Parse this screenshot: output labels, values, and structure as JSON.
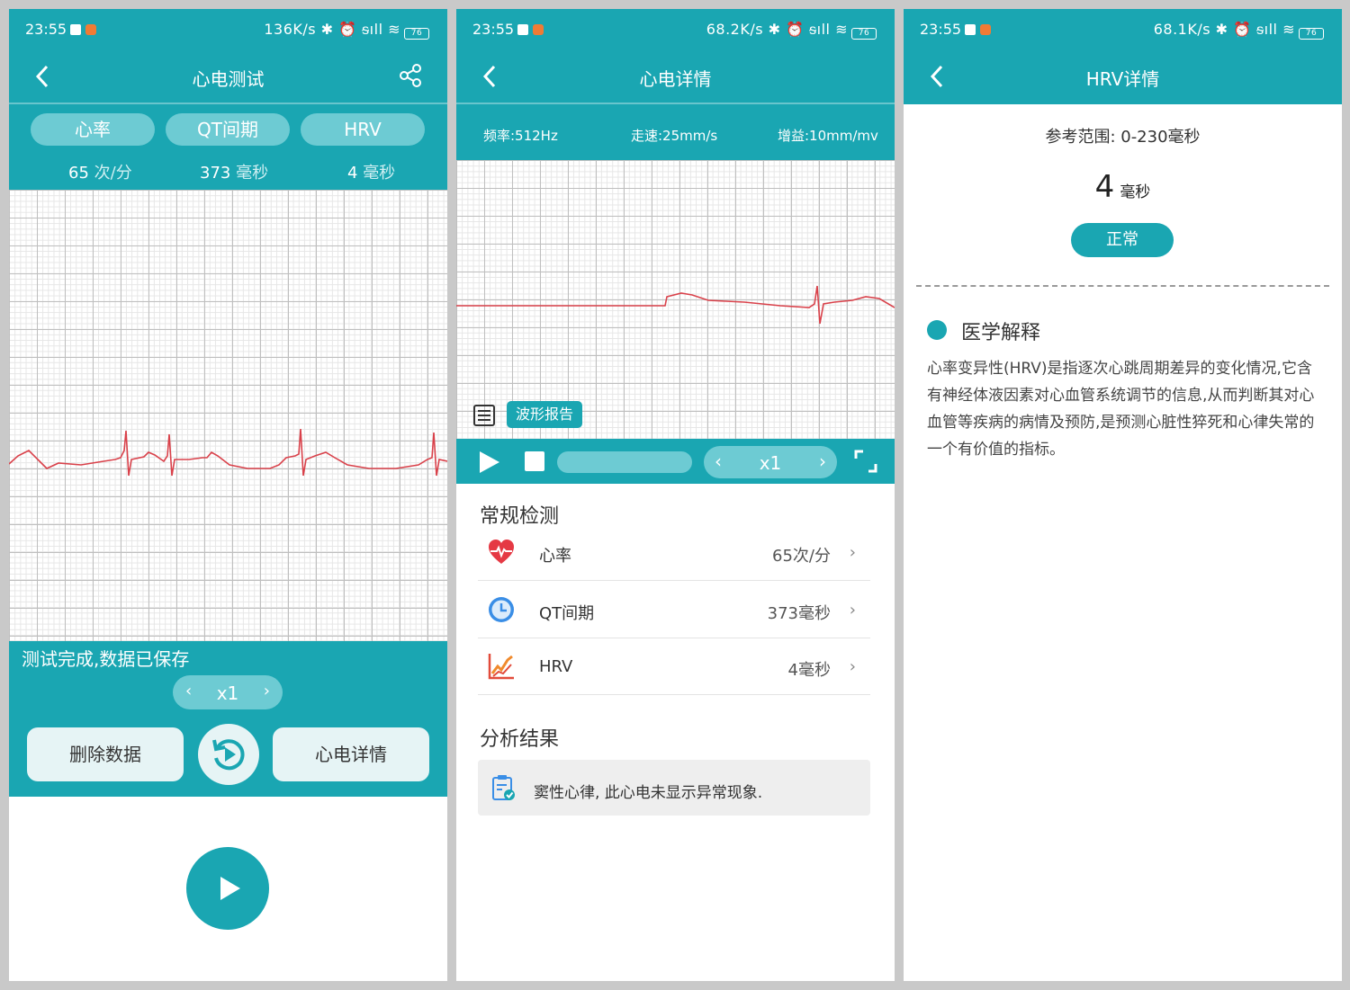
{
  "phone1": {
    "status": {
      "time": "23:55",
      "right": "136K/s ✱ ⏰ ᵴıll ≋"
    },
    "battery": "76",
    "title": "心电测试",
    "tabs": [
      {
        "label": "心率",
        "num": "65",
        "unit": "次/分"
      },
      {
        "label": "QT间期",
        "num": "373",
        "unit": "毫秒"
      },
      {
        "label": "HRV",
        "num": "4",
        "unit": "毫秒"
      }
    ],
    "message": "测试完成,数据已保存",
    "speed": {
      "lt": "‹",
      "val": "x1",
      "gt": "›"
    },
    "delete_label": "删除数据",
    "detail_label": "心电详情"
  },
  "phone2": {
    "status": {
      "time": "23:55",
      "right": "68.2K/s ✱ ⏰ ᵴıll ≋"
    },
    "battery": "76",
    "title": "心电详情",
    "info": {
      "freq": "频率:512Hz",
      "speed": "走速:25mm/s",
      "gain": "增益:10mm/mv"
    },
    "wave_report": "波形报告",
    "speed": {
      "lt": "‹",
      "val": "x1",
      "gt": "›"
    },
    "section1": "常规检测",
    "rows": [
      {
        "label": "心率",
        "value": "65次/分",
        "icon": "heart-icon"
      },
      {
        "label": "QT间期",
        "value": "373毫秒",
        "icon": "clock-icon"
      },
      {
        "label": "HRV",
        "value": "4毫秒",
        "icon": "chart-icon"
      }
    ],
    "chev": "›",
    "section2": "分析结果",
    "result": "窦性心律, 此心电未显示异常现象."
  },
  "phone3": {
    "status": {
      "time": "23:55",
      "right": "68.1K/s ✱ ⏰ ᵴıll ≋"
    },
    "battery": "76",
    "title": "HRV详情",
    "reference": "参考范围: 0-230毫秒",
    "value": "4",
    "unit": "毫秒",
    "normal": "正常",
    "med_title": "医学解释",
    "med_text": "心率变异性(HRV)是指逐次心跳周期差异的变化情况,它含有神经体液因素对心血管系统调节的信息,从而判断其对心血管等疾病的病情及预防,是预测心脏性猝死和心律失常的一个有价值的指标。"
  },
  "colors": {
    "primary": "#1aa6b2",
    "light": "#6dcbd3",
    "ecg": "#d9414a"
  }
}
